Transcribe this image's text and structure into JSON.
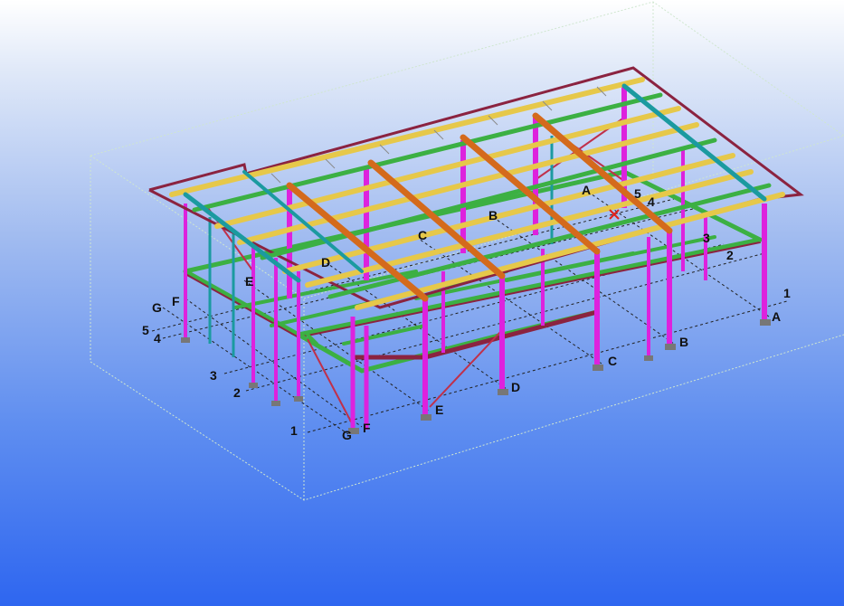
{
  "viewport": {
    "background_top": "#ffffff",
    "background_bottom": "#2e66f0",
    "background_mid": "#9fbaf0",
    "view_type": "3D perspective model view"
  },
  "colors": {
    "bounding_box": "#cfe6cf",
    "column_magenta": "#dd22dd",
    "column_teal": "#1b9aa0",
    "beam_green": "#3cb043",
    "beam_yellow": "#e6c84a",
    "bracing_orange": "#d46a1c",
    "roof_edge": "#8b2340",
    "gridline": "#222222"
  },
  "grid_labels": {
    "near_letters": [
      "G",
      "F",
      "E",
      "D",
      "C",
      "B",
      "A"
    ],
    "near_numbers": [
      "1",
      "2",
      "3",
      "4",
      "5"
    ],
    "far_letters": [
      "G",
      "F",
      "E",
      "D",
      "C",
      "B",
      "A"
    ],
    "far_numbers": [
      "1",
      "2",
      "3",
      "4",
      "5"
    ]
  },
  "labels": {
    "front_G": "G",
    "front_F": "F",
    "front_E": "E",
    "front_D": "D",
    "front_C": "C",
    "front_B": "B",
    "front_A": "A",
    "left_1": "1",
    "left_2": "2",
    "left_3": "3",
    "left_4": "4",
    "left_5": "5",
    "left_G": "G",
    "left_F": "F",
    "right_1": "1",
    "right_2": "2",
    "right_3": "3",
    "right_4": "4",
    "right_5": "5",
    "top_A": "A",
    "top_B": "B",
    "top_C": "C",
    "top_D": "D",
    "top_E": "E"
  }
}
